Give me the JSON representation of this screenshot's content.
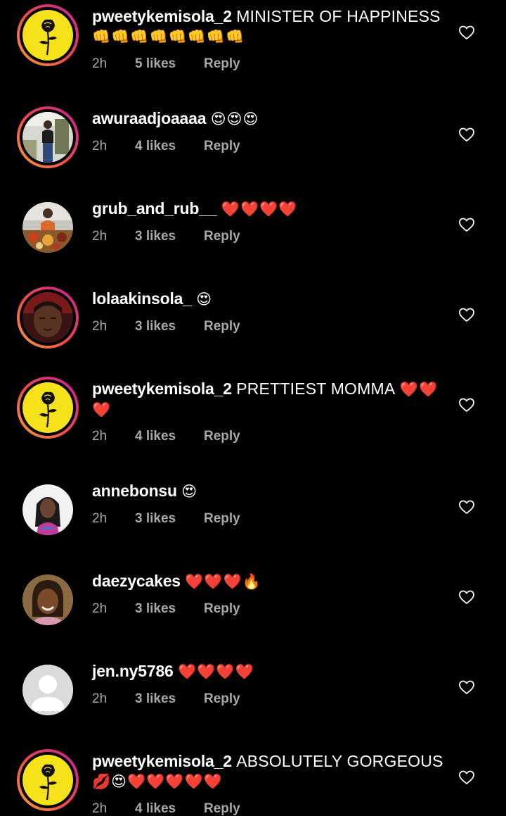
{
  "comments": [
    {
      "username": "pweetykemisola_2",
      "text": "MINISTER OF HAPPINESS",
      "emoji_line2": "👊👊👊👊👊👊👊👊",
      "time": "2h",
      "likes": "5 likes",
      "reply": "Reply",
      "avatar": "yellow-rose"
    },
    {
      "username": "awuraadjoaaaa",
      "text": "",
      "emoji_inline": "😍😍😍",
      "time": "2h",
      "likes": "4 likes",
      "reply": "Reply",
      "avatar": "photo-woman-standing"
    },
    {
      "username": "grub_and_rub__",
      "text": "",
      "emoji_inline": "❤️❤️❤️❤️",
      "time": "2h",
      "likes": "3 likes",
      "reply": "Reply",
      "avatar": "photo-food-table"
    },
    {
      "username": "lolaakinsola_",
      "text": "",
      "emoji_inline": "😍",
      "time": "2h",
      "likes": "3 likes",
      "reply": "Reply",
      "avatar": "photo-selfie"
    },
    {
      "username": "pweetykemisola_2",
      "text": "PRETTIEST MOMMA",
      "emoji_inline": "❤️❤️",
      "emoji_line2": "❤️",
      "time": "2h",
      "likes": "4 likes",
      "reply": "Reply",
      "avatar": "yellow-rose"
    },
    {
      "username": "annebonsu",
      "text": "",
      "emoji_inline": "😍",
      "time": "2h",
      "likes": "3 likes",
      "reply": "Reply",
      "avatar": "photo-woman-braids"
    },
    {
      "username": "daezycakes",
      "text": "",
      "emoji_inline": "❤️❤️❤️🔥",
      "time": "2h",
      "likes": "3 likes",
      "reply": "Reply",
      "avatar": "photo-woman-smiling"
    },
    {
      "username": "jen.ny5786",
      "text": "",
      "emoji_inline": "❤️❤️❤️❤️",
      "time": "2h",
      "likes": "3 likes",
      "reply": "Reply",
      "avatar": "default-user"
    },
    {
      "username": "pweetykemisola_2",
      "text": "ABSOLUTELY GORGEOUS",
      "emoji_line2": "💋😍❤️❤️❤️❤️❤️",
      "time": "2h",
      "likes": "4 likes",
      "reply": "Reply",
      "avatar": "yellow-rose"
    }
  ],
  "icons": {
    "like": "heart-outline-icon"
  },
  "colors": {
    "background": "#000000",
    "text": "#ffffff",
    "meta": "#a8a8a8",
    "story_ring_start": "#f8a13b",
    "story_ring_end": "#c2277e",
    "rose_background": "#f5e21b"
  }
}
